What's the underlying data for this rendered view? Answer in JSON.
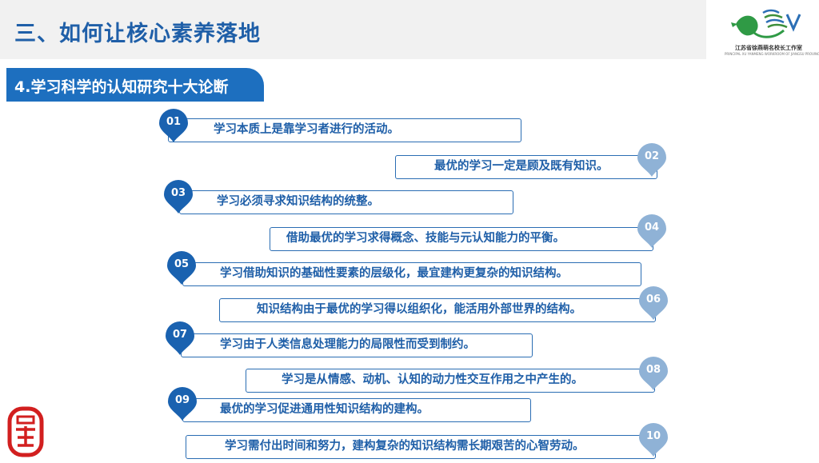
{
  "header": {
    "title": "三、如何让核心素养落地",
    "logo": {
      "name": "江苏省徐燕萌名校长工作室",
      "subtitle": "PRINCIPAL XU YANMENG WORKROOM OF JIANGSU PROVINCE"
    }
  },
  "section": {
    "title": "4.学习科学的认知研究十大论断"
  },
  "items": [
    {
      "num": "01",
      "text": "学习本质上是靠学习者进行的活动。"
    },
    {
      "num": "02",
      "text": "最优的学习一定是顾及既有知识。"
    },
    {
      "num": "03",
      "text": "学习必须寻求知识结构的统整。"
    },
    {
      "num": "04",
      "text": "借助最优的学习求得概念、技能与元认知能力的平衡。"
    },
    {
      "num": "05",
      "text": "学习借助知识的基础性要素的层级化，最宜建构更复杂的知识结构。"
    },
    {
      "num": "06",
      "text": "知识结构由于最优的学习得以组织化，能活用外部世界的结构。"
    },
    {
      "num": "07",
      "text": "学习由于人类信息处理能力的局限性而受到制约。"
    },
    {
      "num": "08",
      "text": "学习是从情感、动机、认知的动力性交互作用之中产生的。"
    },
    {
      "num": "09",
      "text": "最优的学习促进通用性知识结构的建构。"
    },
    {
      "num": "10",
      "text": "学习需付出时间和努力，建构复杂的知识结构需长期艰苦的心智劳动。"
    }
  ],
  "colors": {
    "accent": "#1d6fbf",
    "pin_dark": "#1a62b0",
    "pin_light": "#8fb2d6",
    "text": "#1f5fa8"
  }
}
